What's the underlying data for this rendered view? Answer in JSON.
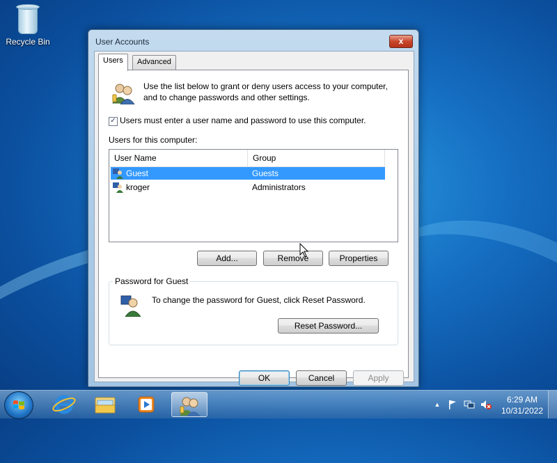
{
  "desktop": {
    "icons": [
      {
        "label": "Recycle Bin",
        "icon": "recycle-bin-icon"
      }
    ]
  },
  "window": {
    "title": "User Accounts",
    "close_glyph": "x",
    "tabs": [
      {
        "label": "Users",
        "active": true
      },
      {
        "label": "Advanced",
        "active": false
      }
    ],
    "intro_text": "Use the list below to grant or deny users access to your computer, and to change passwords and other settings.",
    "checkbox": {
      "label": "Users must enter a user name and password to use this computer.",
      "checked": true,
      "glyph": "✓"
    },
    "users_label": "Users for this computer:",
    "table": {
      "columns": [
        "User Name",
        "Group"
      ],
      "rows": [
        {
          "name": "Guest",
          "group": "Guests",
          "selected": true
        },
        {
          "name": "kroger",
          "group": "Administrators",
          "selected": false
        }
      ]
    },
    "buttons": {
      "add": "Add...",
      "remove": "Remove",
      "properties": "Properties",
      "reset_password": "Reset Password...",
      "ok": "OK",
      "cancel": "Cancel",
      "apply": "Apply"
    },
    "password_group": {
      "title": "Password for Guest",
      "text": "To change the password for Guest, click Reset Password."
    }
  },
  "taskbar": {
    "items": [
      {
        "name": "Internet Explorer",
        "icon": "internet-explorer-icon",
        "active": false
      },
      {
        "name": "Windows Explorer",
        "icon": "folder-icon",
        "active": false
      },
      {
        "name": "Windows Media Player",
        "icon": "media-player-icon",
        "active": false
      },
      {
        "name": "User Accounts",
        "icon": "user-accounts-icon",
        "active": true
      }
    ],
    "tray": {
      "time": "6:29 AM",
      "date": "10/31/2022",
      "up_arrow_glyph": "▲"
    }
  },
  "colors": {
    "selection": "#3399ff",
    "desktop": "#1670c4"
  }
}
